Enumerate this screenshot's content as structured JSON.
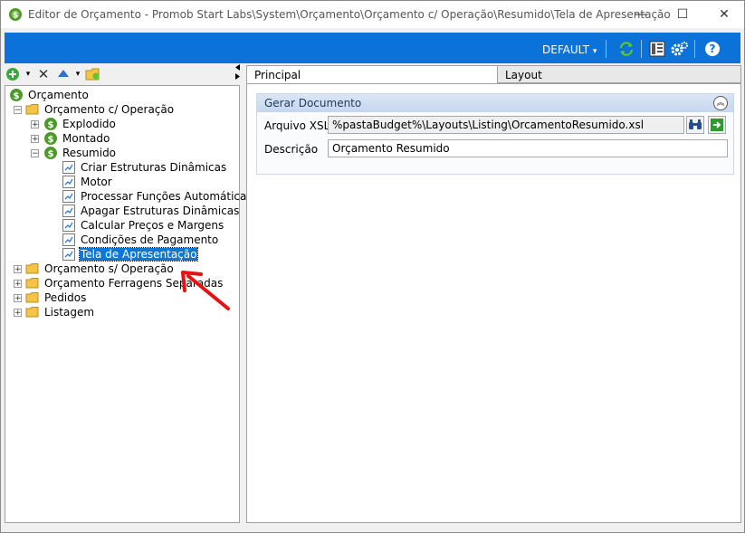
{
  "window": {
    "title": "Editor de Orçamento - Promob Start Labs\\System\\Orçamento\\Orçamento c/ Operação\\Resumido\\Tela de Apresentação",
    "minimize_glyph": "—",
    "maximize_glyph": "☐",
    "close_glyph": "✕"
  },
  "toolbar": {
    "profile_label": "DEFAULT",
    "profile_arrow": "▾",
    "help_glyph": "?",
    "accent_color": "#0a72d8"
  },
  "left_tools": {
    "dropdown_glyph": "▾",
    "delete_glyph": "✕"
  },
  "tree": {
    "root": "Orçamento",
    "orcamento_com_operacao": "Orçamento c/ Operação",
    "explodido": "Explodido",
    "montado": "Montado",
    "resumido": "Resumido",
    "resumido_children": [
      "Criar Estruturas Dinâmicas",
      "Motor",
      "Processar Funções Automáticas",
      "Apagar Estruturas Dinâmicas",
      "Calcular Preços e Margens",
      "Condições de Pagamento",
      "Tela de Apresentação"
    ],
    "top_folders": [
      "Orçamento s/ Operação",
      "Orçamento Ferragens Separadas",
      "Pedidos",
      "Listagem"
    ],
    "selected_item": "Tela de Apresentação",
    "expanded_glyph": "−",
    "collapsed_glyph": "+"
  },
  "tabs": {
    "principal": "Principal",
    "layout": "Layout"
  },
  "group": {
    "title": "Gerar Documento",
    "collapse_glyph": "︽"
  },
  "fields": {
    "arquivo_xsl_label": "Arquivo XSL",
    "arquivo_xsl_value": "%pastaBudget%\\Layouts\\Listing\\OrcamentoResumido.xsl",
    "descricao_label": "Descrição",
    "descricao_value": "Orçamento Resumido"
  }
}
